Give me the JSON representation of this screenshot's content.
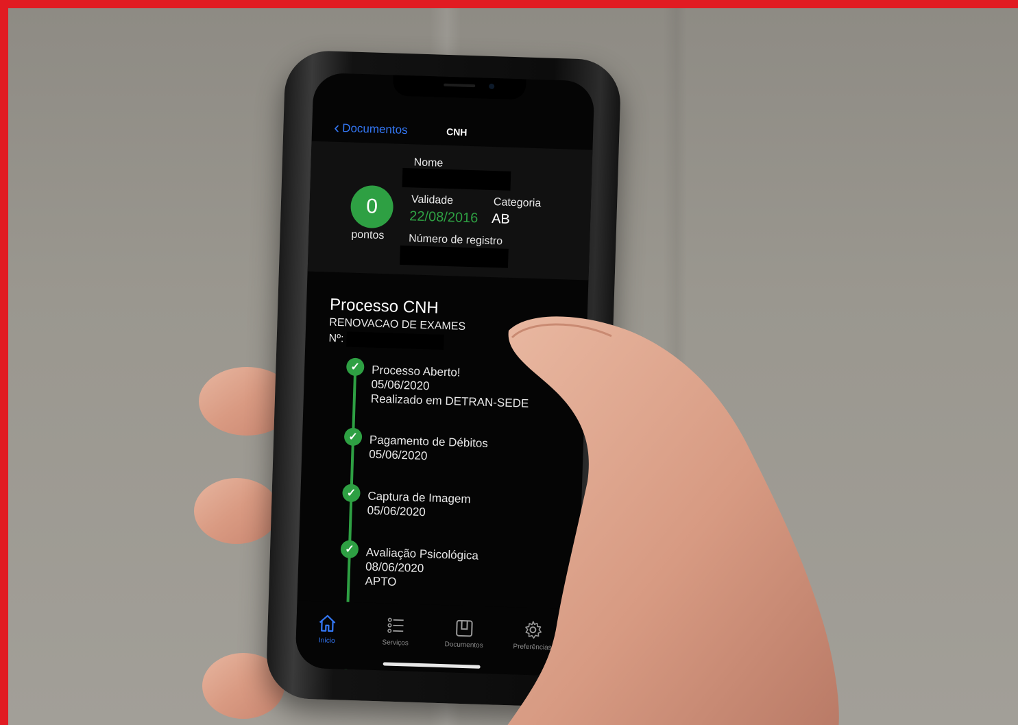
{
  "header": {
    "back_label": "Documentos",
    "title": "CNH"
  },
  "card": {
    "points_value": "0",
    "points_label": "pontos",
    "name_label": "Nome",
    "validity_label": "Validade",
    "validity_value": "22/08/2016",
    "category_label": "Categoria",
    "category_value": "AB",
    "registration_label": "Número de registro"
  },
  "process": {
    "title": "Processo CNH",
    "subtitle": "RENOVACAO DE EXAMES",
    "number_label": "Nº:"
  },
  "steps": [
    {
      "title": "Processo Aberto!",
      "date": "05/06/2020",
      "detail": "Realizado em DETRAN-SEDE"
    },
    {
      "title": "Pagamento de Débitos",
      "date": "05/06/2020",
      "detail": ""
    },
    {
      "title": "Captura de Imagem",
      "date": "05/06/2020",
      "detail": ""
    },
    {
      "title": "Avaliação Psicológica",
      "date": "08/06/2020",
      "detail": "APTO"
    }
  ],
  "tabbar": [
    {
      "label": "Início",
      "icon": "home-icon",
      "active": true
    },
    {
      "label": "Serviços",
      "icon": "list-icon",
      "active": false
    },
    {
      "label": "Documentos",
      "icon": "document-icon",
      "active": false
    },
    {
      "label": "Preferências",
      "icon": "gear-icon",
      "active": false
    }
  ],
  "colors": {
    "accent_blue": "#3478f6",
    "status_green": "#2ea043",
    "frame_red": "#e11b22"
  }
}
